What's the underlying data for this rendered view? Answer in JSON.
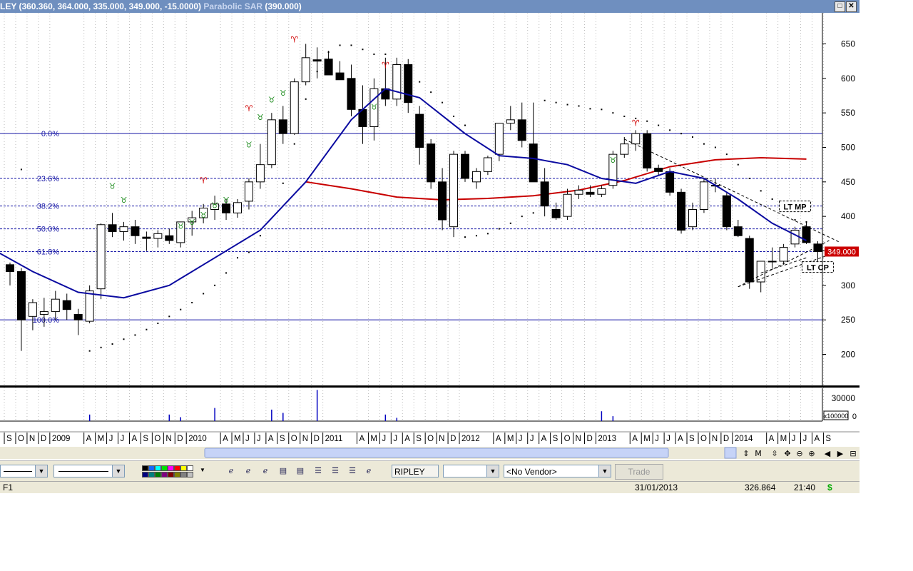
{
  "window": {
    "title_main": "LEY (360.360, 364.000, 335.000, 349.000, -15.0000)",
    "title_indicator": "Parabolic SAR",
    "title_indicator_value": "(390.000)",
    "restore_label": "□",
    "close_label": "✕"
  },
  "chart_data": {
    "type": "candlestick",
    "period": "monthly",
    "ylim": [
      155,
      695
    ],
    "y_ticks": [
      200,
      250,
      300,
      350,
      400,
      450,
      500,
      550,
      600,
      650
    ],
    "grid": true,
    "x_labels": [
      {
        "i": 0,
        "t": "S"
      },
      {
        "i": 1,
        "t": "O"
      },
      {
        "i": 2,
        "t": "N"
      },
      {
        "i": 3,
        "t": "D"
      },
      {
        "i": 4,
        "t": "2009"
      },
      {
        "i": 7,
        "t": "A"
      },
      {
        "i": 8,
        "t": "M"
      },
      {
        "i": 9,
        "t": "J"
      },
      {
        "i": 10,
        "t": "J"
      },
      {
        "i": 11,
        "t": "A"
      },
      {
        "i": 12,
        "t": "S"
      },
      {
        "i": 13,
        "t": "O"
      },
      {
        "i": 14,
        "t": "N"
      },
      {
        "i": 15,
        "t": "D"
      },
      {
        "i": 16,
        "t": "2010"
      },
      {
        "i": 19,
        "t": "A"
      },
      {
        "i": 20,
        "t": "M"
      },
      {
        "i": 21,
        "t": "J"
      },
      {
        "i": 22,
        "t": "J"
      },
      {
        "i": 23,
        "t": "A"
      },
      {
        "i": 24,
        "t": "S"
      },
      {
        "i": 25,
        "t": "O"
      },
      {
        "i": 26,
        "t": "N"
      },
      {
        "i": 27,
        "t": "D"
      },
      {
        "i": 28,
        "t": "2011"
      },
      {
        "i": 31,
        "t": "A"
      },
      {
        "i": 32,
        "t": "M"
      },
      {
        "i": 33,
        "t": "J"
      },
      {
        "i": 34,
        "t": "J"
      },
      {
        "i": 35,
        "t": "A"
      },
      {
        "i": 36,
        "t": "S"
      },
      {
        "i": 37,
        "t": "O"
      },
      {
        "i": 38,
        "t": "N"
      },
      {
        "i": 39,
        "t": "D"
      },
      {
        "i": 40,
        "t": "2012"
      },
      {
        "i": 43,
        "t": "A"
      },
      {
        "i": 44,
        "t": "M"
      },
      {
        "i": 45,
        "t": "J"
      },
      {
        "i": 46,
        "t": "J"
      },
      {
        "i": 47,
        "t": "A"
      },
      {
        "i": 48,
        "t": "S"
      },
      {
        "i": 49,
        "t": "O"
      },
      {
        "i": 50,
        "t": "N"
      },
      {
        "i": 51,
        "t": "D"
      },
      {
        "i": 52,
        "t": "2013"
      },
      {
        "i": 55,
        "t": "A"
      },
      {
        "i": 56,
        "t": "M"
      },
      {
        "i": 57,
        "t": "J"
      },
      {
        "i": 58,
        "t": "J"
      },
      {
        "i": 59,
        "t": "A"
      },
      {
        "i": 60,
        "t": "S"
      },
      {
        "i": 61,
        "t": "O"
      },
      {
        "i": 62,
        "t": "N"
      },
      {
        "i": 63,
        "t": "D"
      },
      {
        "i": 64,
        "t": "2014"
      },
      {
        "i": 67,
        "t": "A"
      },
      {
        "i": 68,
        "t": "M"
      },
      {
        "i": 69,
        "t": "J"
      },
      {
        "i": 70,
        "t": "J"
      },
      {
        "i": 71,
        "t": "A"
      },
      {
        "i": 72,
        "t": "S"
      }
    ],
    "candles": [
      [
        0,
        330,
        333,
        300,
        320
      ],
      [
        1,
        320,
        325,
        205,
        250
      ],
      [
        2,
        255,
        280,
        235,
        275
      ],
      [
        3,
        258,
        282,
        240,
        262
      ],
      [
        4,
        262,
        292,
        250,
        280
      ],
      [
        5,
        278,
        288,
        250,
        265
      ],
      [
        6,
        258,
        266,
        228,
        250
      ],
      [
        7,
        248,
        300,
        245,
        292
      ],
      [
        8,
        295,
        390,
        280,
        388
      ],
      [
        9,
        388,
        405,
        370,
        378
      ],
      [
        10,
        378,
        392,
        365,
        385
      ],
      [
        11,
        385,
        395,
        360,
        372
      ],
      [
        12,
        370,
        378,
        350,
        368
      ],
      [
        13,
        368,
        380,
        355,
        375
      ],
      [
        14,
        372,
        382,
        360,
        365
      ],
      [
        15,
        362,
        392,
        355,
        392
      ],
      [
        16,
        392,
        408,
        372,
        398
      ],
      [
        17,
        398,
        418,
        390,
        412
      ],
      [
        18,
        410,
        430,
        395,
        418
      ],
      [
        19,
        418,
        425,
        395,
        405
      ],
      [
        20,
        405,
        425,
        398,
        420
      ],
      [
        21,
        422,
        455,
        410,
        450
      ],
      [
        22,
        450,
        505,
        440,
        475
      ],
      [
        23,
        475,
        550,
        470,
        540
      ],
      [
        24,
        540,
        560,
        505,
        520
      ],
      [
        25,
        520,
        600,
        518,
        595
      ],
      [
        26,
        595,
        650,
        590,
        630
      ],
      [
        27,
        627,
        645,
        600,
        625
      ],
      [
        28,
        628,
        640,
        605,
        605
      ],
      [
        29,
        608,
        625,
        598,
        598
      ],
      [
        30,
        600,
        620,
        545,
        555
      ],
      [
        31,
        555,
        590,
        505,
        530
      ],
      [
        32,
        530,
        600,
        510,
        585
      ],
      [
        33,
        585,
        630,
        560,
        570
      ],
      [
        34,
        570,
        630,
        560,
        620
      ],
      [
        35,
        620,
        628,
        550,
        565
      ],
      [
        36,
        548,
        560,
        475,
        500
      ],
      [
        37,
        505,
        512,
        440,
        450
      ],
      [
        38,
        450,
        470,
        380,
        395
      ],
      [
        39,
        385,
        495,
        370,
        490
      ],
      [
        40,
        490,
        495,
        450,
        455
      ],
      [
        41,
        450,
        470,
        440,
        465
      ],
      [
        42,
        465,
        488,
        460,
        485
      ],
      [
        43,
        490,
        535,
        480,
        535
      ],
      [
        44,
        535,
        560,
        525,
        540
      ],
      [
        45,
        540,
        565,
        500,
        510
      ],
      [
        46,
        505,
        565,
        460,
        450
      ],
      [
        47,
        450,
        470,
        400,
        415
      ],
      [
        48,
        410,
        420,
        395,
        398
      ],
      [
        49,
        400,
        440,
        395,
        432
      ],
      [
        50,
        432,
        445,
        425,
        438
      ],
      [
        51,
        435,
        445,
        428,
        432
      ],
      [
        52,
        432,
        445,
        428,
        440
      ],
      [
        53,
        445,
        495,
        440,
        490
      ],
      [
        54,
        490,
        515,
        485,
        505
      ],
      [
        55,
        505,
        525,
        495,
        520
      ],
      [
        56,
        520,
        525,
        465,
        470
      ],
      [
        57,
        470,
        475,
        460,
        465
      ],
      [
        58,
        465,
        470,
        430,
        435
      ],
      [
        59,
        435,
        440,
        375,
        380
      ],
      [
        60,
        385,
        420,
        380,
        410
      ],
      [
        61,
        410,
        455,
        405,
        450
      ],
      [
        62,
        445,
        455,
        435,
        445
      ],
      [
        63,
        430,
        435,
        380,
        385
      ],
      [
        64,
        385,
        395,
        370,
        372
      ],
      [
        65,
        368,
        372,
        295,
        305
      ],
      [
        66,
        305,
        335,
        290,
        335
      ],
      [
        67,
        335,
        355,
        325,
        335
      ],
      [
        68,
        335,
        360,
        330,
        355
      ],
      [
        69,
        360,
        385,
        355,
        380
      ],
      [
        70,
        385,
        392,
        360,
        362
      ],
      [
        71,
        360,
        364,
        335,
        349
      ]
    ],
    "ma_blue": [
      [
        -8,
        410
      ],
      [
        -4,
        375
      ],
      [
        2,
        320
      ],
      [
        6,
        290
      ],
      [
        10,
        282
      ],
      [
        14,
        300
      ],
      [
        18,
        340
      ],
      [
        22,
        380
      ],
      [
        26,
        450
      ],
      [
        30,
        540
      ],
      [
        33,
        585
      ],
      [
        36,
        572
      ],
      [
        40,
        520
      ],
      [
        43,
        488
      ],
      [
        46,
        484
      ],
      [
        49,
        475
      ],
      [
        52,
        455
      ],
      [
        55,
        448
      ],
      [
        58,
        465
      ],
      [
        61,
        455
      ],
      [
        64,
        425
      ],
      [
        67,
        390
      ],
      [
        70,
        365
      ]
    ],
    "ma_red": [
      [
        26,
        450
      ],
      [
        30,
        440
      ],
      [
        34,
        428
      ],
      [
        38,
        424
      ],
      [
        42,
        426
      ],
      [
        46,
        430
      ],
      [
        50,
        438
      ],
      [
        54,
        452
      ],
      [
        58,
        472
      ],
      [
        62,
        482
      ],
      [
        66,
        485
      ],
      [
        70,
        483
      ]
    ],
    "sar_dots": [
      [
        -4,
        400
      ],
      [
        -2,
        430
      ],
      [
        1,
        468
      ],
      [
        7,
        205
      ],
      [
        8,
        210
      ],
      [
        9,
        215
      ],
      [
        10,
        222
      ],
      [
        11,
        228
      ],
      [
        12,
        236
      ],
      [
        13,
        245
      ],
      [
        14,
        255
      ],
      [
        15,
        265
      ],
      [
        16,
        275
      ],
      [
        17,
        288
      ],
      [
        18,
        300
      ],
      [
        19,
        318
      ],
      [
        20,
        340
      ],
      [
        21,
        348
      ],
      [
        22,
        372
      ],
      [
        24,
        448
      ],
      [
        25,
        505
      ],
      [
        26,
        570
      ],
      [
        27,
        610
      ],
      [
        28,
        638
      ],
      [
        29,
        648
      ],
      [
        30,
        648
      ],
      [
        31,
        642
      ],
      [
        32,
        635
      ],
      [
        33,
        635
      ],
      [
        34,
        620
      ],
      [
        35,
        608
      ],
      [
        36,
        595
      ],
      [
        37,
        580
      ],
      [
        38,
        565
      ],
      [
        39,
        545
      ],
      [
        40,
        532
      ],
      [
        40,
        370
      ],
      [
        41,
        372
      ],
      [
        42,
        375
      ],
      [
        43,
        382
      ],
      [
        44,
        390
      ],
      [
        45,
        400
      ],
      [
        46,
        405
      ],
      [
        47,
        568
      ],
      [
        48,
        565
      ],
      [
        49,
        562
      ],
      [
        50,
        560
      ],
      [
        51,
        556
      ],
      [
        52,
        555
      ],
      [
        53,
        550
      ],
      [
        54,
        545
      ],
      [
        55,
        542
      ],
      [
        56,
        538
      ],
      [
        57,
        532
      ],
      [
        58,
        525
      ],
      [
        59,
        520
      ],
      [
        60,
        515
      ],
      [
        61,
        505
      ],
      [
        62,
        500
      ],
      [
        63,
        490
      ],
      [
        64,
        475
      ],
      [
        65,
        455
      ],
      [
        66,
        437
      ],
      [
        67,
        425
      ],
      [
        68,
        408
      ],
      [
        69,
        395
      ],
      [
        70,
        392
      ]
    ],
    "fib_levels": [
      {
        "label": "0.0%",
        "value": 520
      },
      {
        "label": "23.6%",
        "value": 455
      },
      {
        "label": "38.2%",
        "value": 415
      },
      {
        "label": "50.0%",
        "value": 382
      },
      {
        "label": "61.8%",
        "value": 349
      },
      {
        "label": "100.0%",
        "value": 250
      }
    ],
    "current_price_label": "349.000",
    "current_price": 349,
    "annotations": [
      {
        "text": "LT MP",
        "at": [
          69,
          413
        ]
      },
      {
        "text": "LT CP",
        "at": [
          71,
          325
        ]
      }
    ],
    "trendlines": [
      [
        [
          54,
          512
        ],
        [
          73,
          362
        ]
      ],
      [
        [
          64,
          298
        ],
        [
          73,
          350
        ]
      ],
      [
        [
          64,
          298
        ],
        [
          72,
          365
        ]
      ],
      [
        [
          66,
          318
        ],
        [
          70,
          340
        ]
      ]
    ],
    "volume": {
      "ylabels": [
        "30000",
        "x100000",
        "0"
      ],
      "bars": [
        [
          7,
          0.2
        ],
        [
          14,
          0.2
        ],
        [
          15,
          0.12
        ],
        [
          18,
          0.4
        ],
        [
          23,
          0.35
        ],
        [
          24,
          0.25
        ],
        [
          27,
          0.95
        ],
        [
          33,
          0.2
        ],
        [
          34,
          0.1
        ],
        [
          52,
          0.3
        ],
        [
          53,
          0.15
        ]
      ]
    },
    "bull_markers": [
      [
        9,
        440
      ],
      [
        10,
        420
      ],
      [
        15,
        382
      ],
      [
        16,
        388
      ],
      [
        17,
        398
      ],
      [
        18,
        412
      ],
      [
        19,
        420
      ],
      [
        21,
        500
      ],
      [
        22,
        540
      ],
      [
        23,
        565
      ],
      [
        24,
        575
      ],
      [
        32,
        555
      ],
      [
        53,
        478
      ]
    ],
    "bear_markers": [
      [
        17,
        448
      ],
      [
        21,
        552
      ],
      [
        25,
        652
      ],
      [
        33,
        615
      ],
      [
        55,
        531
      ]
    ]
  },
  "toolbar": {
    "symbol": "RIPLEY",
    "vendor": "<No Vendor>",
    "trade_label": "Trade"
  },
  "status": {
    "left": "F1",
    "date": "31/01/2013",
    "value": "326.864",
    "time": "21:40",
    "currency": "$"
  }
}
